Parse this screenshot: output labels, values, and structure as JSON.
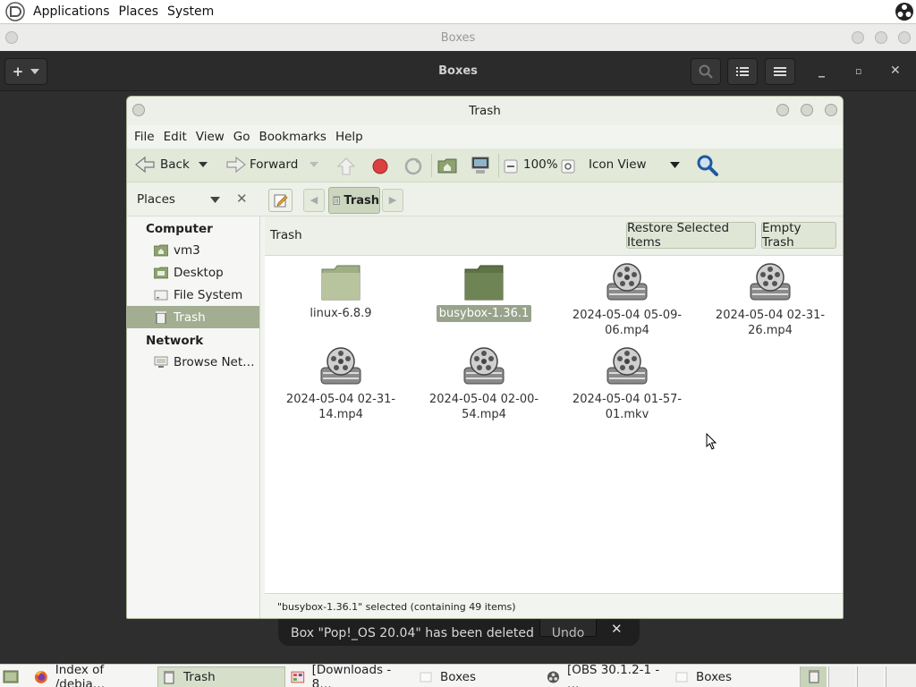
{
  "top_panel": {
    "menus": [
      "Applications",
      "Places",
      "System"
    ]
  },
  "boxes": {
    "window_title": "Boxes",
    "header_title": "Boxes",
    "add_label": "+"
  },
  "notification": {
    "message": "Box \"Pop!_OS 20.04\" has been deleted",
    "undo_label": "Undo",
    "close_label": "✕"
  },
  "caja": {
    "title": "Trash",
    "menubar": [
      "File",
      "Edit",
      "View",
      "Go",
      "Bookmarks",
      "Help"
    ],
    "toolbar": {
      "back_label": "Back",
      "forward_label": "Forward",
      "zoom_level": "100%",
      "view_mode": "Icon View"
    },
    "locbar": {
      "path_button": "Trash"
    },
    "sidebar": {
      "header_label": "Places",
      "sections": [
        {
          "title": "Computer",
          "items": [
            "vm3",
            "Desktop",
            "File System",
            "Trash"
          ]
        },
        {
          "title": "Network",
          "items": [
            "Browse Net…"
          ]
        }
      ],
      "selected": "Trash"
    },
    "content": {
      "header_label": "Trash",
      "restore_button": "Restore Selected Items",
      "empty_button": "Empty Trash",
      "files": [
        {
          "name": "linux-6.8.9",
          "type": "folder",
          "selected": false
        },
        {
          "name": "busybox-1.36.1",
          "type": "folder",
          "selected": true
        },
        {
          "name": "2024-05-04 05-09-06.mp4",
          "type": "video",
          "selected": false
        },
        {
          "name": "2024-05-04 02-31-26.mp4",
          "type": "video",
          "selected": false
        },
        {
          "name": "2024-05-04 02-31-14.mp4",
          "type": "video",
          "selected": false
        },
        {
          "name": "2024-05-04 02-00-54.mp4",
          "type": "video",
          "selected": false
        },
        {
          "name": "2024-05-04 01-57-01.mkv",
          "type": "video",
          "selected": false
        }
      ]
    },
    "statusbar": "\"busybox-1.36.1\" selected (containing 49 items)"
  },
  "taskbar": {
    "items": [
      {
        "label": "Index of /debia…",
        "icon": "firefox-icon"
      },
      {
        "label": "Trash",
        "icon": "trash-icon",
        "active": true
      },
      {
        "label": "[Downloads - 8…",
        "icon": "file-manager-icon"
      },
      {
        "label": "Boxes",
        "icon": "boxes-icon"
      },
      {
        "label": "[OBS 30.1.2-1 - …",
        "icon": "obs-icon"
      },
      {
        "label": "Boxes",
        "icon": "boxes-icon"
      }
    ]
  },
  "colors": {
    "accent": "#a3ad91",
    "selection": "#98a38c",
    "toolbar_bg": "#e2e9d9"
  }
}
